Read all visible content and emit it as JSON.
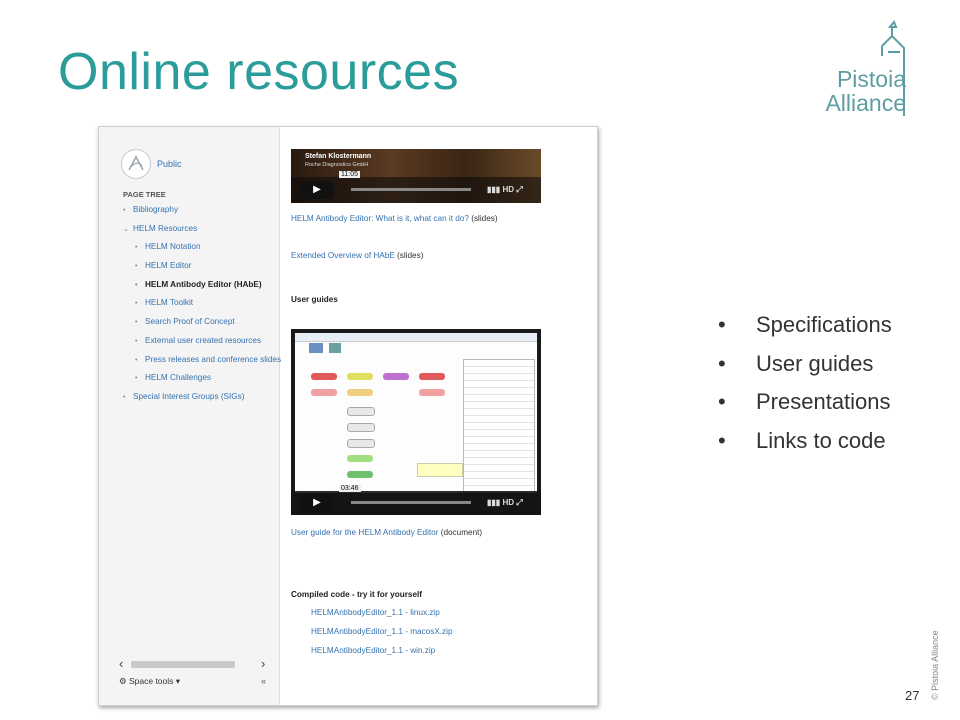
{
  "slide": {
    "title": "Online resources",
    "page_number": "27",
    "copyright": "© Pistoia Alliance",
    "logo": {
      "line1": "Pistoia",
      "line2": "Alliance"
    },
    "accent_color": "#2a9d9a",
    "bullets": [
      "Specifications",
      "User guides",
      "Presentations",
      "Links to code"
    ]
  },
  "screenshot": {
    "sidebar": {
      "space_name": "Public",
      "page_tree_label": "PAGE TREE",
      "items": [
        {
          "label": "Bibliography"
        },
        {
          "label": "HELM Resources"
        },
        {
          "label": "HELM Notation"
        },
        {
          "label": "HELM Editor"
        },
        {
          "label": "HELM Antibody Editor (HAbE)"
        },
        {
          "label": "HELM Toolkit"
        },
        {
          "label": "Search Proof of Concept"
        },
        {
          "label": "External user created resources"
        },
        {
          "label": "Press releases and conference slides"
        },
        {
          "label": "HELM Challenges"
        },
        {
          "label": "Special Interest Groups (SIGs)"
        }
      ],
      "space_tools": "Space tools ▾",
      "collapse_glyph": "«"
    },
    "content": {
      "video1": {
        "presenter": "Stefan Klostermann",
        "org": "Roche Diagnostics GmbH",
        "time": "11:05",
        "hd": "HD"
      },
      "link1": {
        "link_text": "HELM Antibody Editor: What is it, what can it do?",
        "suffix": " (slides)"
      },
      "link2": {
        "link_text": "Extended Overview of HAbE",
        "suffix": " (slides)"
      },
      "user_guides_heading": "User guides",
      "video2": {
        "time": "03:46",
        "hd": "HD"
      },
      "link3": {
        "link_text": "User guide for the HELM Antibody Editor",
        "suffix": " (document)"
      },
      "compiled_heading": "Compiled code - try it for yourself",
      "downloads": [
        "HELMAntibodyEditor_1.1 - linux.zip",
        "HELMAntibodyEditor_1.1 - macosX.zip",
        "HELMAntibodyEditor_1.1 - win.zip"
      ]
    }
  }
}
